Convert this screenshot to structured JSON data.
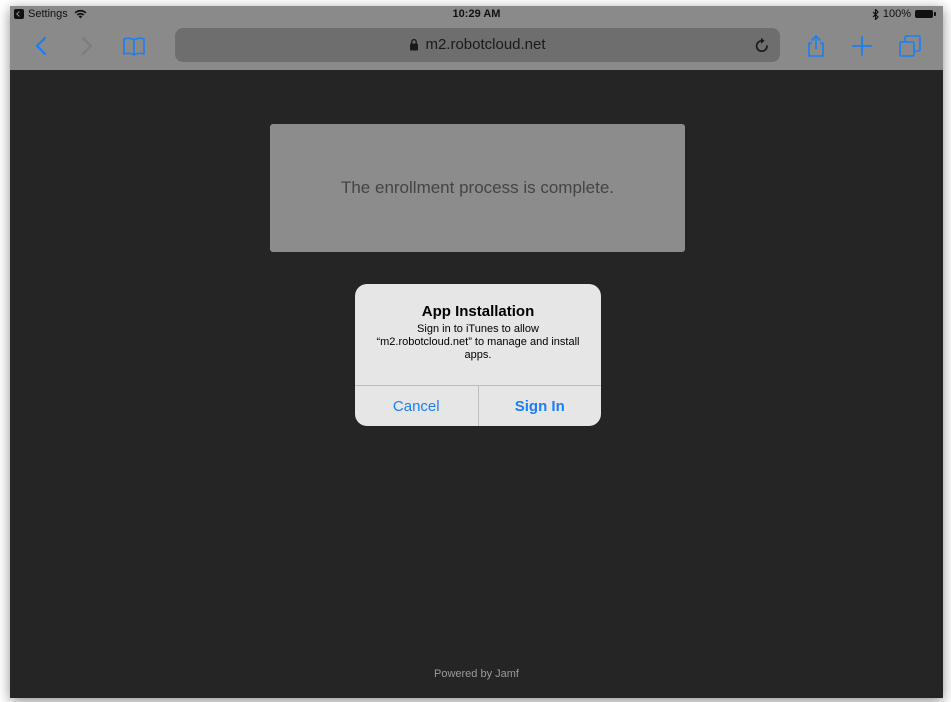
{
  "status_bar": {
    "back_app_label": "Settings",
    "time": "10:29 AM",
    "battery": "100%"
  },
  "toolbar": {
    "address": "m2.robotcloud.net",
    "icons": [
      "back-chevron",
      "forward-chevron",
      "bookmarks-book",
      "lock",
      "reload",
      "share",
      "new-tab-plus",
      "tabs-overview"
    ]
  },
  "page": {
    "enrollment_message": "The enrollment process is complete.",
    "footer": "Powered by Jamf"
  },
  "alert": {
    "title": "App Installation",
    "message": "Sign in to iTunes to allow “m2.robotcloud.net” to manage and install apps.",
    "cancel_label": "Cancel",
    "sign_in_label": "Sign In"
  },
  "colors": {
    "accent": "#1a7ef5",
    "page_background": "#252525",
    "chrome_background": "#8a8a8a"
  }
}
